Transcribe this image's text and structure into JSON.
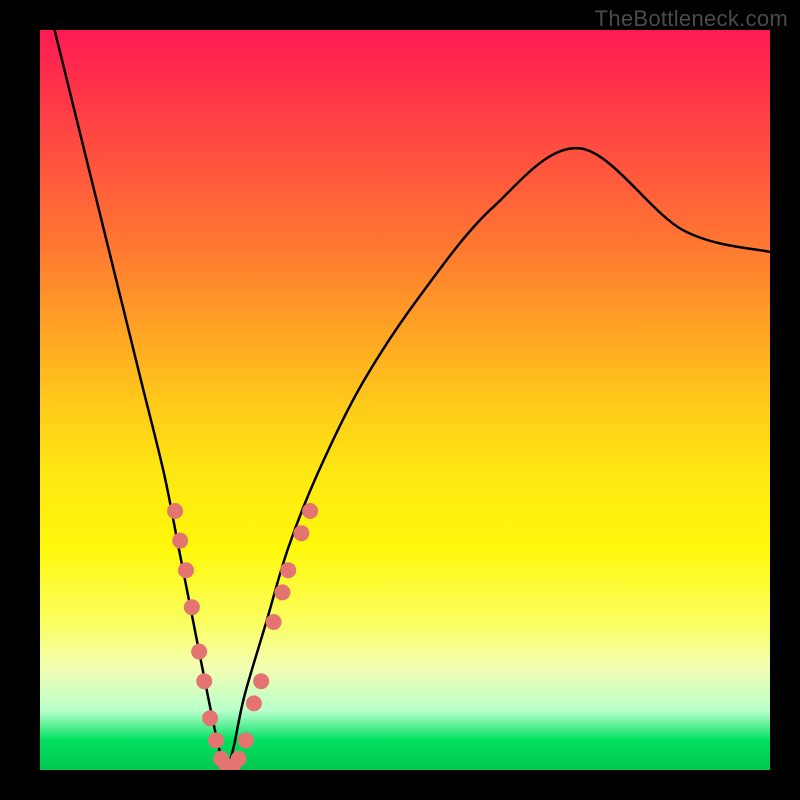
{
  "watermark": "TheBottleneck.com",
  "chart_data": {
    "type": "line",
    "title": "",
    "xlabel": "",
    "ylabel": "",
    "xlim": [
      0,
      100
    ],
    "ylim": [
      0,
      100
    ],
    "background_gradient": {
      "top": "#ff1a52",
      "mid": "#ffe812",
      "bottom": "#00c850"
    },
    "series": [
      {
        "name": "bottleneck-curve",
        "x": [
          2,
          5,
          8,
          11,
          14,
          17,
          19,
          21,
          23,
          24.5,
          25.5,
          26.5,
          28,
          31,
          34,
          38,
          44,
          52,
          62,
          74,
          88,
          100
        ],
        "y": [
          100,
          88,
          76,
          64,
          52,
          40,
          30,
          20,
          10,
          3,
          0,
          3,
          10,
          20,
          30,
          40,
          52,
          64,
          76,
          84,
          73,
          70
        ],
        "color": "#000000"
      }
    ],
    "markers": [
      {
        "name": "scatter-dots",
        "color": "#e4746f",
        "radius": 8,
        "points": [
          {
            "x": 18.5,
            "y": 35
          },
          {
            "x": 19.2,
            "y": 31
          },
          {
            "x": 20.0,
            "y": 27
          },
          {
            "x": 20.8,
            "y": 22
          },
          {
            "x": 21.8,
            "y": 16
          },
          {
            "x": 22.5,
            "y": 12
          },
          {
            "x": 23.3,
            "y": 7
          },
          {
            "x": 24.1,
            "y": 4
          },
          {
            "x": 24.8,
            "y": 1.5
          },
          {
            "x": 25.6,
            "y": 0.5
          },
          {
            "x": 26.4,
            "y": 0.5
          },
          {
            "x": 27.2,
            "y": 1.5
          },
          {
            "x": 28.2,
            "y": 4
          },
          {
            "x": 29.3,
            "y": 9
          },
          {
            "x": 30.3,
            "y": 12
          },
          {
            "x": 32.0,
            "y": 20
          },
          {
            "x": 33.2,
            "y": 24
          },
          {
            "x": 34.0,
            "y": 27
          },
          {
            "x": 35.8,
            "y": 32
          },
          {
            "x": 37.0,
            "y": 35
          }
        ]
      }
    ]
  }
}
